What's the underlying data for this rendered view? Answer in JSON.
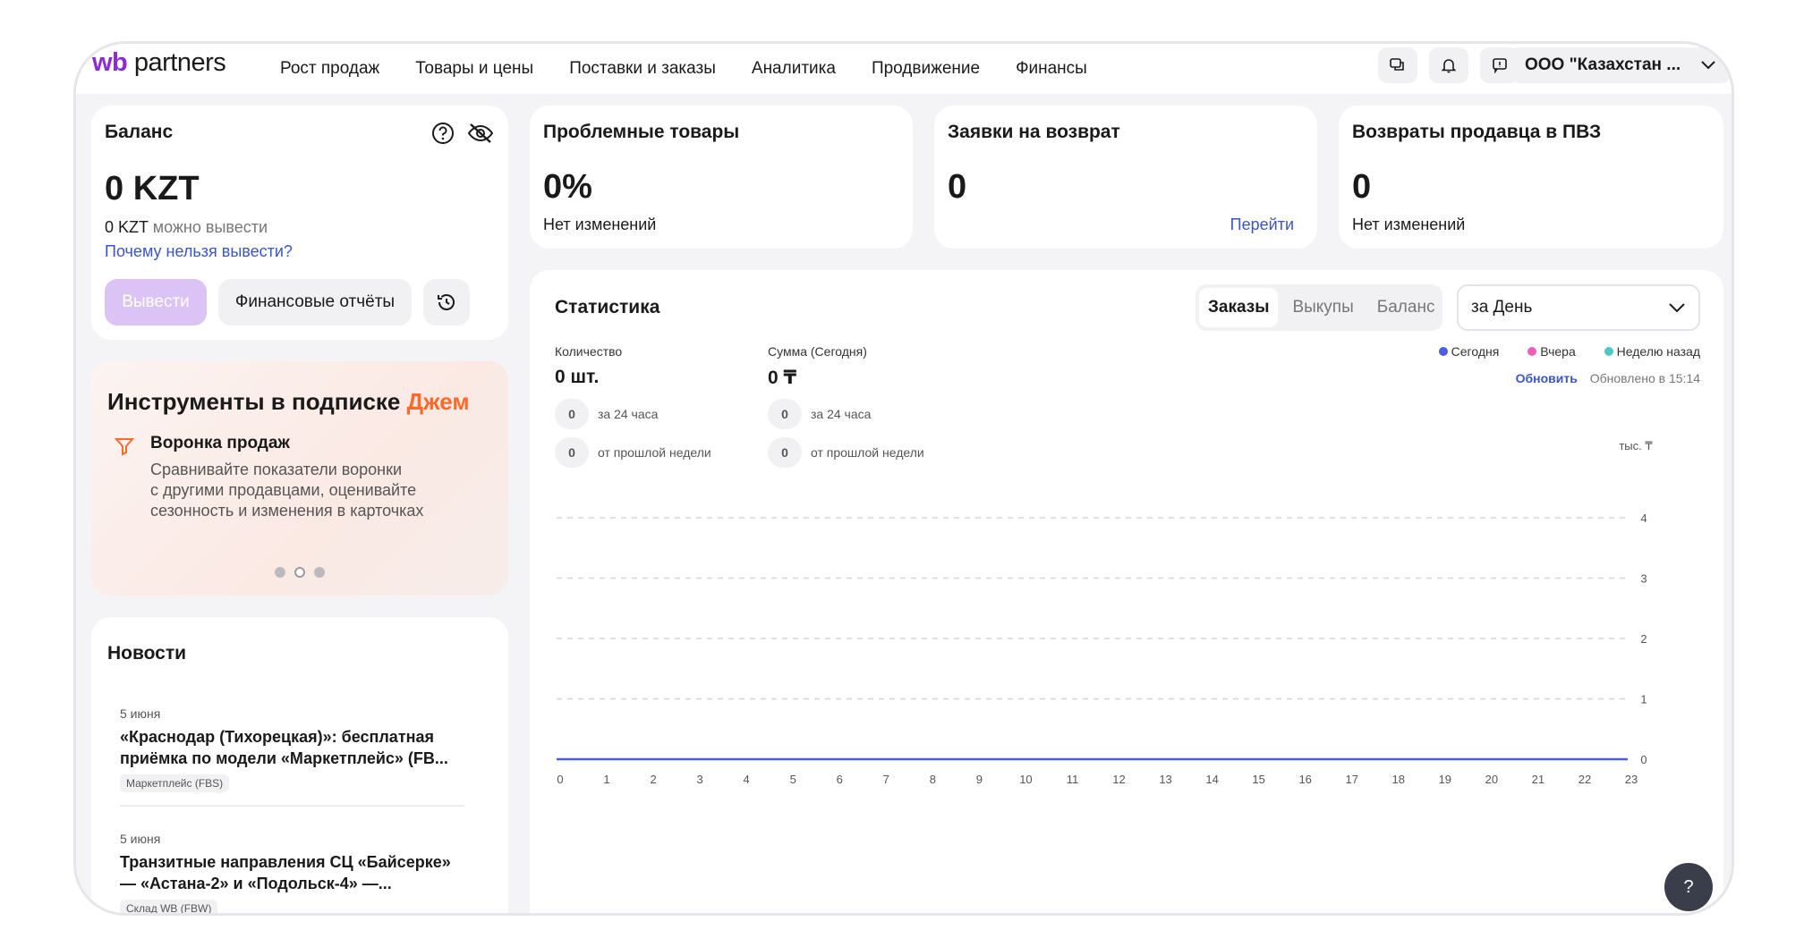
{
  "logo": {
    "wb": "wb",
    "partners": "partners"
  },
  "nav": {
    "items": [
      "Рост продаж",
      "Товары и цены",
      "Поставки и заказы",
      "Аналитика",
      "Продвижение",
      "Финансы"
    ],
    "icons": [
      "chat-icon",
      "bell-icon",
      "feedback-icon"
    ],
    "org_label": "ООО \"Казахстан ..."
  },
  "balance": {
    "title": "Баланс",
    "amount": "0 KZT",
    "withdrawable_amount": "0 KZT",
    "withdrawable_text": "можно вывести",
    "why_link": "Почему нельзя вывести?",
    "withdraw_button": "Вывести",
    "reports_button": "Финансовые отчёты"
  },
  "problem_goods": {
    "title": "Проблемные товары",
    "value": "0%",
    "change": "Нет изменений"
  },
  "return_requests": {
    "title": "Заявки на возврат",
    "value": "0",
    "link": "Перейти"
  },
  "seller_returns": {
    "title": "Возвраты продавца в ПВЗ",
    "value": "0",
    "change": "Нет изменений"
  },
  "promo": {
    "title": "Инструменты в подписке",
    "title_accent": "Джем",
    "accent_color": "#ff6a2a",
    "feature_title": "Воронка продаж",
    "feature_lines": [
      "Сравнивайте показатели воронки",
      "с другими продавцами, оценивайте",
      "сезонность и изменения в карточках"
    ],
    "carousel_active_index": 1
  },
  "news": {
    "title": "Новости",
    "items": [
      {
        "date": "5 июня",
        "line1": "«Краснодар (Тихорецкая)»: бесплатная",
        "line2": "приёмка по модели «Маркетплейс» (FB...",
        "tag": "Маркетплейс (FBS)"
      },
      {
        "date": "5 июня",
        "line1": "Транзитные направления СЦ «Байсерке»",
        "line2": "— «Астана-2» и «Подольск-4» —...",
        "tag": "Склад WB (FBW)"
      }
    ]
  },
  "stats": {
    "title": "Статистика",
    "tabs": [
      "Заказы",
      "Выкупы",
      "Баланс"
    ],
    "active_tab": "Заказы",
    "period": "за День",
    "quantity_label": "Количество",
    "quantity_value": "0 шт.",
    "sum_label": "Сумма (Сегодня)",
    "sum_value": "0 ₸",
    "qty_24h": "0",
    "qty_24h_label": "за 24 часа",
    "qty_week": "0",
    "qty_week_label": "от прошлой недели",
    "sum_24h": "0",
    "sum_24h_label": "за 24 часа",
    "sum_week": "0",
    "sum_week_label": "от прошлой недели",
    "legend": [
      {
        "name": "Сегодня",
        "color": "#4a5ce0"
      },
      {
        "name": "Вчера",
        "color": "#ee5fbc"
      },
      {
        "name": "Неделю назад",
        "color": "#4cc9c0"
      }
    ],
    "refresh_link": "Обновить",
    "updated_text": "Обновлено в 15:14"
  },
  "chart_data": {
    "type": "line",
    "x": [
      0,
      1,
      2,
      3,
      4,
      5,
      6,
      7,
      8,
      9,
      10,
      11,
      12,
      13,
      14,
      15,
      16,
      17,
      18,
      19,
      20,
      21,
      22,
      23
    ],
    "y_unit": "тыс. ₸",
    "ylim": [
      0,
      4
    ],
    "yticks": [
      0,
      1,
      2,
      3,
      4
    ],
    "grid": true,
    "series": [
      {
        "name": "Сегодня",
        "color": "#4a5ce0",
        "values": [
          0,
          0,
          0,
          0,
          0,
          0,
          0,
          0,
          0,
          0,
          0,
          0,
          0,
          0,
          0,
          0,
          0,
          0,
          0,
          0,
          0,
          0,
          0,
          0
        ]
      }
    ]
  },
  "help_label": "?"
}
